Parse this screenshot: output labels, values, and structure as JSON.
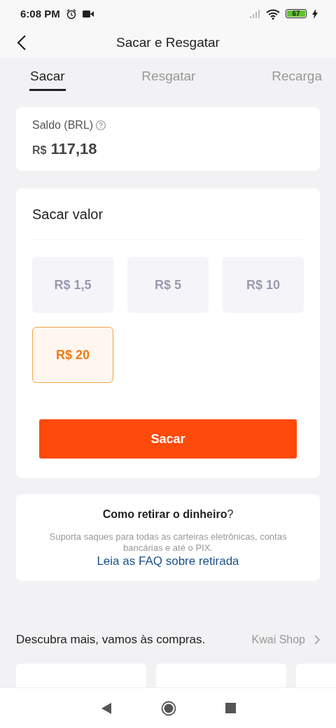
{
  "status_bar": {
    "time": "6:08 PM",
    "battery": "67"
  },
  "header": {
    "title": "Sacar e Resgatar"
  },
  "tabs": [
    {
      "label": "Sacar",
      "selected": true
    },
    {
      "label": "Resgatar",
      "selected": false
    },
    {
      "label": "Recarga",
      "selected": false
    }
  ],
  "balance": {
    "label": "Saldo (BRL)",
    "currency": "R$",
    "amount": "117,18"
  },
  "withdraw": {
    "title": "Sacar valor",
    "options": [
      {
        "label": "R$ 1,5",
        "selected": false
      },
      {
        "label": "R$ 5",
        "selected": false
      },
      {
        "label": "R$ 10",
        "selected": false
      },
      {
        "label": "R$ 20",
        "selected": true
      }
    ],
    "button": "Sacar"
  },
  "help": {
    "title": "**Como retirar o dinheiro**?",
    "text": "Suporta saques para todas as carteiras eletrônicas, contas bancárias e até o PIX.",
    "link": "Leia as FAQ sobre retirada"
  },
  "shop": {
    "title": "Descubra mais, vamos às compras.",
    "link": "Kwai Shop",
    "cards": [
      {
        "kind": "product"
      },
      {
        "kind": "product"
      },
      {
        "kind": "product"
      }
    ]
  }
}
